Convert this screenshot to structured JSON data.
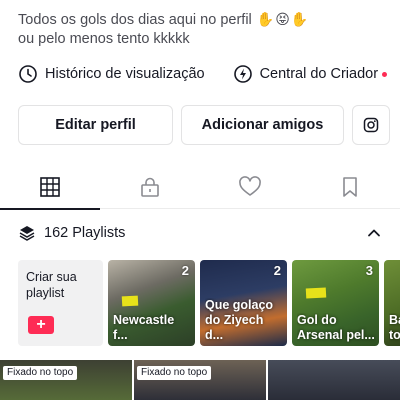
{
  "bio": {
    "line1": "Todos os gols dos dias aqui no perfil",
    "line2": "ou pelo menos tento kkkkk"
  },
  "links": {
    "history_label": "Histórico de visualização",
    "creator_label": "Central do Criador"
  },
  "actions": {
    "edit_label": "Editar perfil",
    "add_friends_label": "Adicionar amigos"
  },
  "tabs": [
    {
      "name": "grid-icon",
      "active": true
    },
    {
      "name": "lock-icon",
      "active": false
    },
    {
      "name": "heart-icon",
      "active": false
    },
    {
      "name": "bookmark-icon",
      "active": false
    }
  ],
  "playlists": {
    "header_label": "162 Playlists",
    "create_label": "Criar sua playlist",
    "create_plus": "+",
    "items": [
      {
        "count": "2",
        "title": "Newcastle f..."
      },
      {
        "count": "2",
        "title": "Que golaço do Ziyech d..."
      },
      {
        "count": "3",
        "title": "Gol do Arsenal pel..."
      },
      {
        "count": "",
        "title": "Ba to"
      }
    ]
  },
  "videos": [
    {
      "pin_label": "Fixado no topo"
    },
    {
      "pin_label": "Fixado no topo"
    },
    {
      "pin_label": ""
    }
  ],
  "colors": {
    "accent": "#fe2c55",
    "text": "#161823",
    "secondary_text": "#4a4b53",
    "border": "#e3e3e4"
  }
}
